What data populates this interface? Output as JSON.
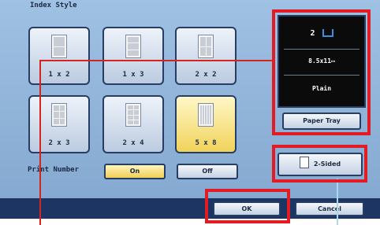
{
  "index_style": {
    "title": "Index Style",
    "options": [
      {
        "label": "1 x 2",
        "rows": 2,
        "cols": 1,
        "selected": false
      },
      {
        "label": "1 x 3",
        "rows": 3,
        "cols": 1,
        "selected": false
      },
      {
        "label": "2 x 2",
        "rows": 2,
        "cols": 2,
        "selected": false
      },
      {
        "label": "2 x 3",
        "rows": 3,
        "cols": 2,
        "selected": false
      },
      {
        "label": "2 x 4",
        "rows": 4,
        "cols": 2,
        "selected": false
      },
      {
        "label": "5 x 8",
        "rows": 8,
        "cols": 5,
        "selected": true
      }
    ]
  },
  "print_number": {
    "label": "Print Number",
    "on_label": "On",
    "off_label": "Off",
    "selected": "On"
  },
  "tray_panel": {
    "tray_number": "2",
    "size": "8.5x11▭",
    "paper_type": "Plain",
    "paper_tray_button": "Paper Tray"
  },
  "two_sided_button": "2-Sided",
  "footer": {
    "ok_label": "OK",
    "cancel_label": "Cancel"
  },
  "colors": {
    "highlight": "#e31c23",
    "selected": "#f0cf55",
    "panel": "#9fc1e3"
  },
  "icons": [
    "tray-icon",
    "two-sided-page-icon",
    "index-thumbnail-icon"
  ]
}
